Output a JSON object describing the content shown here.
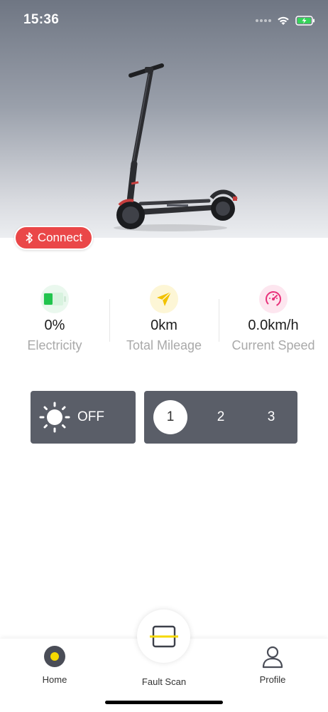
{
  "status_bar": {
    "time": "15:36"
  },
  "connect": {
    "label": "Connect"
  },
  "stats": [
    {
      "value": "0%",
      "label": "Electricity",
      "icon": "battery-icon",
      "color": "#21c44d"
    },
    {
      "value": "0km",
      "label": "Total Mileage",
      "icon": "paper-plane-icon",
      "color": "#f2c200"
    },
    {
      "value": "0.0km/h",
      "label": "Current Speed",
      "icon": "speedometer-icon",
      "color": "#e8317a"
    }
  ],
  "headlight": {
    "state": "OFF",
    "icon": "sun-icon"
  },
  "gears": {
    "options": [
      "1",
      "2",
      "3"
    ],
    "selected": "1"
  },
  "tabbar": {
    "home": "Home",
    "fault_scan": "Fault Scan",
    "profile": "Profile"
  },
  "colors": {
    "accent_red": "#ea4748",
    "control_bg": "#5a5e68",
    "highlight_yellow": "#f5d800"
  }
}
